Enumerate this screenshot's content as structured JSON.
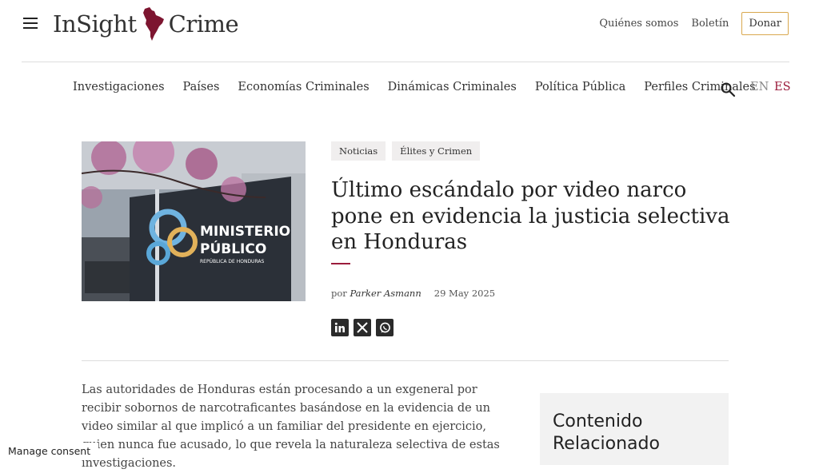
{
  "header": {
    "logo_left": "InSight",
    "logo_right": "Crime",
    "links": [
      "Quiénes somos",
      "Boletín"
    ],
    "donate": "Donar"
  },
  "nav": {
    "items": [
      "Investigaciones",
      "Países",
      "Economías Criminales",
      "Dinámicas Criminales",
      "Política Pública",
      "Perfiles Criminales"
    ],
    "lang_en": "EN",
    "lang_es": "ES"
  },
  "article": {
    "tags": [
      "Noticias",
      "Élites y Crimen"
    ],
    "title": "Último escándalo por video narco pone en evidencia la justicia selectiva en Honduras",
    "by": "por",
    "author": "Parker Asmann",
    "date": "29 May 2025",
    "image_sign_line1": "MINISTERIO",
    "image_sign_line2": "PÚBLICO",
    "image_sign_line3": "REPÚBLICA DE HONDURAS",
    "lead": "Las autoridades de Honduras están procesando a un exgeneral por recibir sobornos de narcotraficantes basándose en la evidencia de un video similar al que implicó a un familiar del presidente en ejercicio, quien nunca fue acusado, lo que revela la naturaleza selectiva de estas investigaciones."
  },
  "sidebar": {
    "related_title": "Contenido Relacionado"
  },
  "consent": {
    "label": "Manage consent"
  },
  "colors": {
    "accent": "#9b1c3c",
    "donate_border": "#d9a84e"
  },
  "icons": [
    "menu-icon",
    "search-icon",
    "linkedin-icon",
    "x-icon",
    "whatsapp-icon"
  ]
}
